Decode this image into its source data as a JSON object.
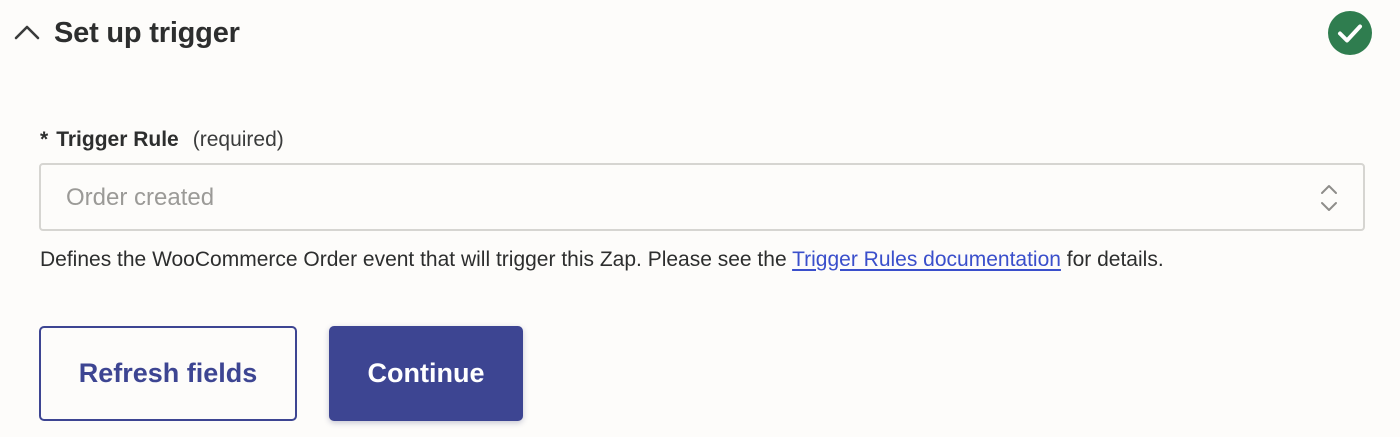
{
  "section": {
    "title": "Set up trigger",
    "collapse_icon": "chevron-up-icon",
    "status_icon": "check-circle-icon",
    "status_color": "#2f7d4f"
  },
  "trigger_rule": {
    "asterisk": "*",
    "label": "Trigger Rule",
    "required_text": "(required)",
    "selected_value": "Order created",
    "dropdown_icon": "select-arrows-icon"
  },
  "help": {
    "text_before": "Defines the WooCommerce Order event that will trigger this Zap. Please see the ",
    "link_text": "Trigger Rules documentation",
    "text_after": " for details."
  },
  "buttons": {
    "refresh_label": "Refresh fields",
    "continue_label": "Continue"
  },
  "colors": {
    "primary": "#3d4592",
    "link": "#3a4fcb",
    "success": "#2f7d4f",
    "background": "#fdfcfa"
  }
}
